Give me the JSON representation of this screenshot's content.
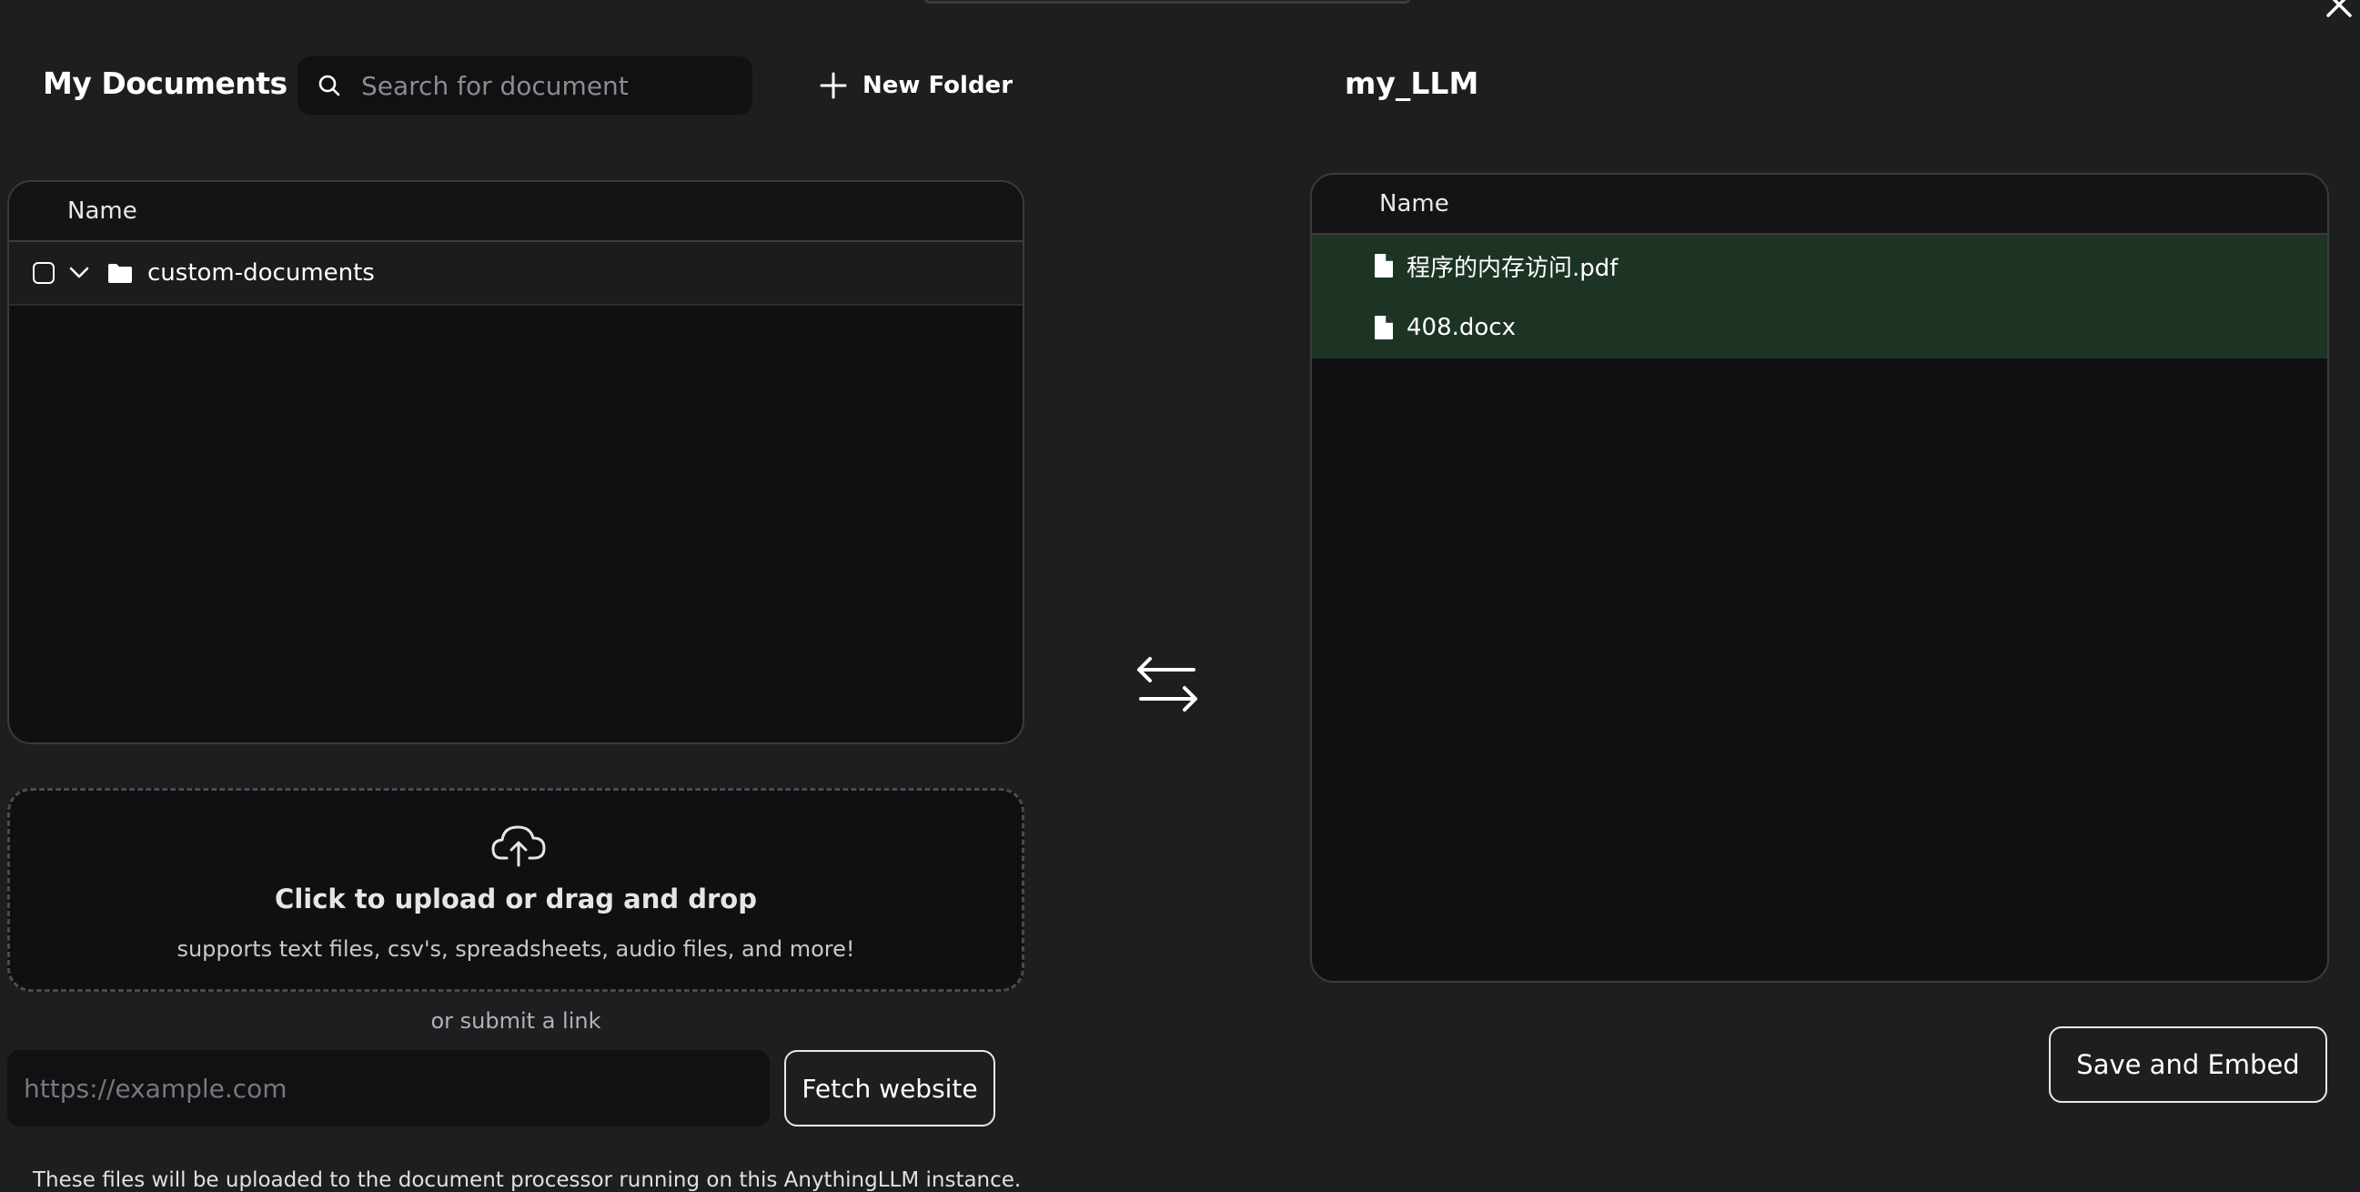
{
  "left_panel": {
    "title": "My Documents",
    "search": {
      "placeholder": "Search for document",
      "value": ""
    },
    "new_folder_label": "New Folder",
    "table": {
      "header": "Name",
      "rows": [
        {
          "type": "folder",
          "name": "custom-documents",
          "checked": false,
          "expanded": true
        }
      ]
    },
    "upload": {
      "title": "Click to upload or drag and drop",
      "subtitle": "supports text files, csv's, spreadsheets, audio files, and more!"
    },
    "link": {
      "or_text": "or submit a link",
      "placeholder": "https://example.com",
      "fetch_label": "Fetch website"
    },
    "footer_note": "These files will be uploaded to the document processor running on this AnythingLLM instance."
  },
  "right_panel": {
    "title": "my_LLM",
    "table": {
      "header": "Name",
      "rows": [
        {
          "type": "file",
          "name": "程序的内存访问.pdf"
        },
        {
          "type": "file",
          "name": "408.docx"
        }
      ]
    },
    "save_label": "Save and Embed"
  },
  "colors": {
    "background": "#1d1e20",
    "panel": "#0e1011",
    "selected_row": "#1d3424",
    "border": "#3a3b3e"
  },
  "icons": [
    "close-icon",
    "search-icon",
    "plus-icon",
    "chevron-down-icon",
    "folder-icon",
    "cloud-upload-icon",
    "swap-arrows-icon",
    "file-icon"
  ]
}
